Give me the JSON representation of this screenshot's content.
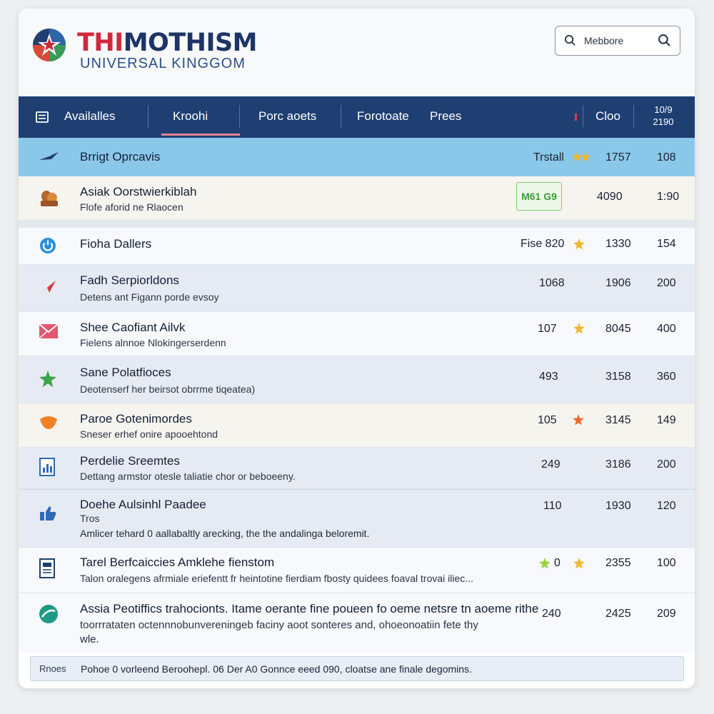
{
  "brand": {
    "title_hl": "THI",
    "title_rest": "MOTHISM",
    "subtitle": "UNIVERSAL KINGGOM"
  },
  "search": {
    "value": "Mebbore"
  },
  "nav": {
    "items": [
      "Availalles",
      "Kroohi",
      "Porc aoets",
      "Forotoate",
      "Prees"
    ],
    "active_index": 1,
    "right_label": "Cloo",
    "stack_top": "10/9",
    "stack_bottom": "2190"
  },
  "highlight_row": {
    "title": "Brrigt Oprcavis",
    "label": "Trstall",
    "c2": "1757",
    "c3": "108"
  },
  "rows": [
    {
      "title": "Asiak Oorstwierkiblah",
      "sub": "Flofe aforid ne Rlaocen",
      "badge": "M61 G9",
      "c2": "4090",
      "c3": "1:90"
    },
    {
      "title": "Fioha Dallers",
      "c1": "Fise 820",
      "c2": "1330",
      "c3": "154"
    },
    {
      "title": "Fadh Serpiorldons",
      "sub": "Detens ant Figann porde evsoy",
      "c1": "1068",
      "c2": "1906",
      "c3": "200"
    },
    {
      "title": "Shee Caofiant Ailvk",
      "sub": "Fielens alnnoe Nlokingerserdenn",
      "c1": "107",
      "c2": "8045",
      "c3": "400"
    },
    {
      "title": "Sane Polatfioces",
      "sub": "Deotenserf her beirsot obrrme tiqeatea)",
      "c1": "493",
      "c2": "3158",
      "c3": "360"
    },
    {
      "title": "Paroe Gotenimordes",
      "sub": "Sneser erhef onire apooehtond",
      "c1": "105",
      "c2": "3145",
      "c3": "149"
    },
    {
      "title": "Perdelie Sreemtes",
      "sub": "Dettang armstor otesle taliatie chor or beboeeny.",
      "c1": "249",
      "c2": "3186",
      "c3": "200"
    },
    {
      "title": "Doehe Aulsinhl Paadee",
      "sub": "Tros",
      "note": "Amlicer tehard 0 aallabaltly arecking, the the andalinga beloremit.",
      "c1": "110",
      "c2": "1930",
      "c3": "120"
    },
    {
      "title": "Tarel Berfcaiccies Amklehe fienstom",
      "sub": "Talon oralegens afrmiale eriefentt fr heintotine fierdiam fbosty quidees foaval trovai iliec...",
      "c1": "0",
      "c2": "2355",
      "c3": "100"
    },
    {
      "title": "Assia Peotiffics trahocionts. Itame oerante fine poueen fo oeme netsre tn aoeme rithe",
      "sub": "toorrrataten octennnobunvereningeb faciny aoot sonteres and, ohoeonoatiin fete thy",
      "note": "wle.",
      "c1": "240",
      "c2": "2425",
      "c3": "209"
    }
  ],
  "footer": {
    "label": "Rnoes",
    "text": "Pohoe 0 vorleend Beroohepl. 06 Der A0 Gonnce eeed 090, cloatse ane finale degomins."
  },
  "colors": {
    "nav_bg": "#1f3f73",
    "highlight_bg": "#8ac8e9",
    "accent_red": "#cf2a3c",
    "star": "#f2b630"
  }
}
